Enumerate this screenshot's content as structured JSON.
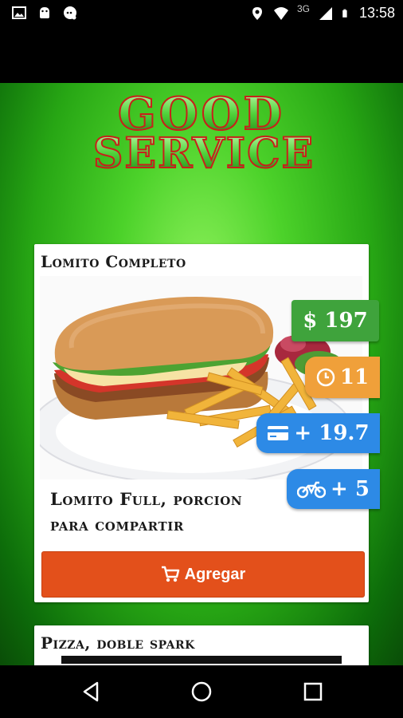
{
  "status_bar": {
    "time": "13:58",
    "network": "3G",
    "icons": [
      "image-icon",
      "android-icon",
      "chat-icon",
      "location-icon",
      "wifi-icon",
      "signal-icon",
      "battery-icon"
    ]
  },
  "logo": {
    "line1": "GOOD",
    "line2": "SERVICE"
  },
  "product": {
    "title": "Lomito Completo",
    "description": "Lomito Full, porcion\npara compartir",
    "price": "$ 197",
    "time": "11",
    "card_surcharge": "+ 19.7",
    "delivery": "+ 5",
    "add_button_label": "Agregar"
  },
  "next_product": {
    "title": "Pizza, doble spark"
  },
  "colors": {
    "price_badge": "#3fa33c",
    "time_badge": "#f0a03a",
    "info_badge": "#2d8ae6",
    "add_button": "#e3501b",
    "background_green": "#27a614"
  }
}
